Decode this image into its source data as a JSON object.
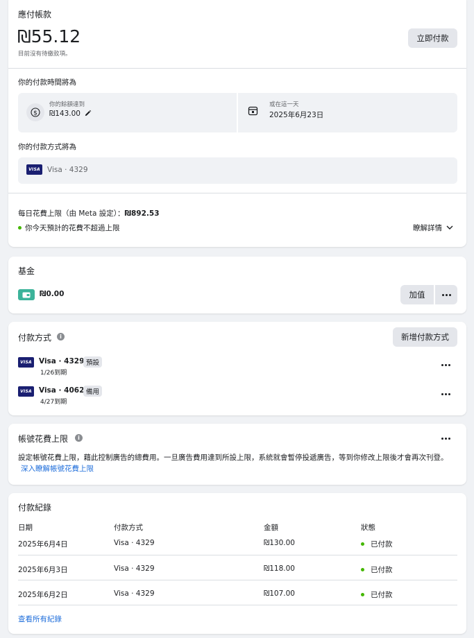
{
  "amount_due": {
    "title": "應付帳款",
    "amount": "₪55.12",
    "note": "目前沒有待繳款項。",
    "pay_now_label": "立即付款",
    "schedule_title": "你的付款時間將為",
    "threshold_caption": "你的餘額達到",
    "threshold_value": "₪143.00",
    "date_caption": "或在這一天",
    "date_value": "2025年6月23日",
    "method_title": "你的付款方式將為",
    "method_value": "Visa · 4329",
    "daily_limit_label": "每日花費上限（由 Meta 設定）：",
    "daily_limit_value": "₪892.53",
    "daily_limit_status": "你今天預計的花費不超過上限",
    "learn_more": "瞭解詳情"
  },
  "funds": {
    "title": "基金",
    "balance": "₪0.00",
    "add_label": "加值"
  },
  "payment_methods": {
    "title": "付款方式",
    "add_label": "新增付款方式",
    "cards": [
      {
        "name": "Visa · 4329",
        "badge": "預設",
        "expiry": "1/26到期"
      },
      {
        "name": "Visa · 4062",
        "badge": "備用",
        "expiry": "4/27到期"
      }
    ]
  },
  "spending_limit": {
    "title": "帳號花費上限",
    "description": "設定帳號花費上限，藉此控制廣告的總費用。一旦廣告費用達到所設上限，系統就會暫停投遞廣告，等到你修改上限後才會再次刊登。",
    "link": "深入瞭解帳號花費上限"
  },
  "history": {
    "title": "付款紀錄",
    "headers": [
      "日期",
      "付款方式",
      "金額",
      "狀態"
    ],
    "rows": [
      {
        "date": "2025年6月4日",
        "method": "Visa · 4329",
        "amount": "₪130.00",
        "status": "已付款"
      },
      {
        "date": "2025年6月3日",
        "method": "Visa · 4329",
        "amount": "₪118.00",
        "status": "已付款"
      },
      {
        "date": "2025年6月2日",
        "method": "Visa · 4329",
        "amount": "₪107.00",
        "status": "已付款"
      }
    ],
    "view_all": "查看所有紀錄"
  },
  "visa_logo_text": "VISA",
  "colors": {
    "status_green": "#44b700",
    "link_blue": "#216fdb",
    "funds_teal": "#3cb39a",
    "visa_navy": "#1a1f71"
  }
}
